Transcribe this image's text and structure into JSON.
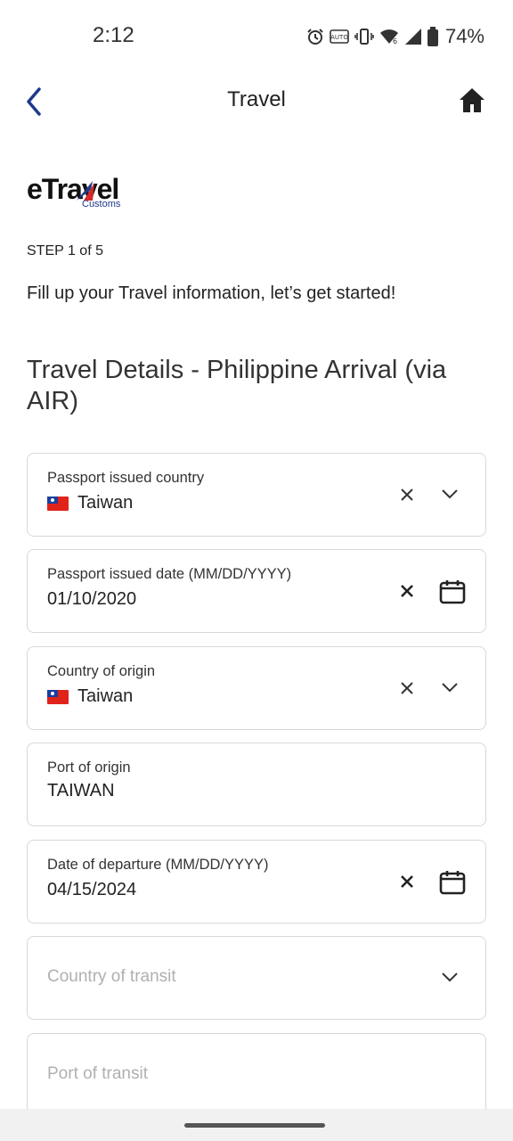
{
  "status_bar": {
    "time": "2:12",
    "battery": "74%",
    "icons": [
      "alarm-icon",
      "auto-brightness-icon",
      "vibrate-icon",
      "wifi-icon",
      "signal-icon",
      "battery-icon"
    ]
  },
  "app_bar": {
    "title": "Travel",
    "back_icon": "back-chevron-icon",
    "home_icon": "home-icon"
  },
  "logo": {
    "main": "eTravel",
    "sub": "Customs",
    "accent_colors": [
      "#1e3a8a",
      "#d62828"
    ]
  },
  "step_text": "STEP 1 of 5",
  "intro_text": "Fill up your Travel information, let’s get started!",
  "section_title": "Travel Details - Philippine Arrival (via AIR)",
  "fields": [
    {
      "label": "Passport issued country",
      "value": "Taiwan",
      "flag": true,
      "has_clear": true,
      "trailing_icon": "chevron-down-icon"
    },
    {
      "label": "Passport issued date (MM/DD/YYYY)",
      "value": "01/10/2020",
      "has_clear": true,
      "trailing_icon": "calendar-icon"
    },
    {
      "label": "Country of origin",
      "value": "Taiwan",
      "flag": true,
      "has_clear": true,
      "trailing_icon": "chevron-down-icon"
    },
    {
      "label": "Port of origin",
      "value": "TAIWAN"
    },
    {
      "label": "Date of departure (MM/DD/YYYY)",
      "value": "04/15/2024",
      "has_clear": true,
      "trailing_icon": "calendar-icon"
    },
    {
      "placeholder": "Country of transit",
      "trailing_icon": "chevron-down-icon"
    },
    {
      "placeholder": "Port of transit"
    }
  ]
}
